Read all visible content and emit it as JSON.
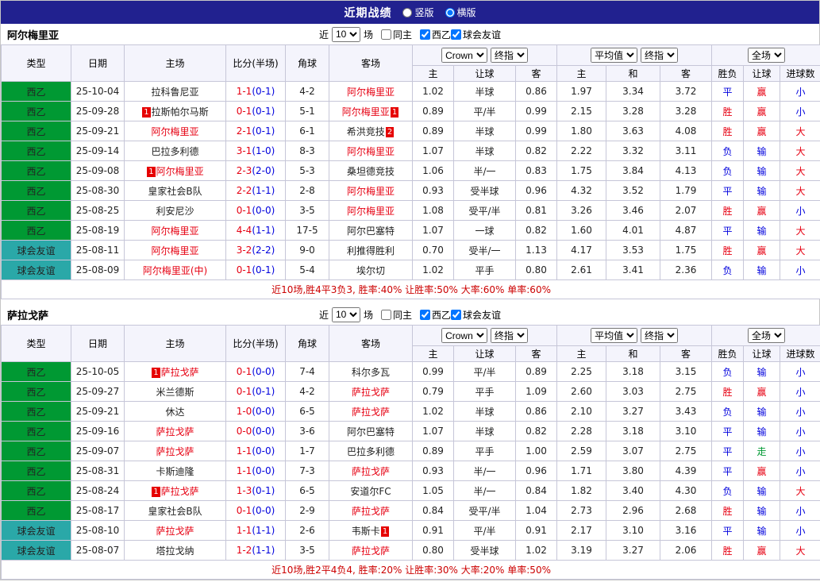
{
  "topbar": {
    "title": "近期战绩",
    "layout_options": [
      {
        "label": "竖版",
        "checked": false
      },
      {
        "label": "横版",
        "checked": true
      }
    ]
  },
  "labels": {
    "near": "近",
    "games": "场",
    "same_home": "同主",
    "league": "西乙",
    "friendly": "球会友谊"
  },
  "controls": {
    "count": "10",
    "bookmaker": "Crown",
    "stage1": "终指",
    "average": "平均值",
    "stage2": "终指",
    "scope": "全场"
  },
  "columns": {
    "type": "类型",
    "date": "日期",
    "home": "主场",
    "score": "比分(半场)",
    "corner": "角球",
    "away": "客场",
    "sub": [
      "主",
      "让球",
      "客",
      "主",
      "和",
      "客",
      "胜负",
      "让球",
      "进球数"
    ]
  },
  "colors": {
    "league": {
      "西乙": "#009933",
      "球会友谊": "#2aa8a8"
    },
    "result": {
      "胜": "#e60012",
      "平": "#0000dd",
      "负": "#0000dd",
      "赢": "#e60012",
      "输": "#0000dd",
      "走": "#009933",
      "大": "#e60012",
      "小": "#0000dd"
    }
  },
  "sections": [
    {
      "team": "阿尔梅里亚",
      "filter": {
        "same_home": false,
        "league_checked": true,
        "friendly_checked": true
      },
      "rows": [
        {
          "league": "西乙",
          "date": "25-10-04",
          "home": {
            "name": "拉科鲁尼亚"
          },
          "score": "1-1",
          "half": "0-1",
          "corner": "4-2",
          "away": {
            "name": "阿尔梅里亚",
            "feat": true
          },
          "odds": [
            "1.02",
            "半球",
            "0.86",
            "1.97",
            "3.34",
            "3.72"
          ],
          "res": [
            "平",
            "赢",
            "小"
          ]
        },
        {
          "league": "西乙",
          "date": "25-09-28",
          "home": {
            "name": "拉斯帕尔马斯",
            "badge_before": "1"
          },
          "score": "0-1",
          "half": "0-1",
          "corner": "5-1",
          "away": {
            "name": "阿尔梅里亚",
            "feat": true,
            "badge_after": "1"
          },
          "odds": [
            "0.89",
            "平/半",
            "0.99",
            "2.15",
            "3.28",
            "3.28"
          ],
          "res": [
            "胜",
            "赢",
            "小"
          ]
        },
        {
          "league": "西乙",
          "date": "25-09-21",
          "home": {
            "name": "阿尔梅里亚",
            "feat": true
          },
          "score": "2-1",
          "half": "0-1",
          "corner": "6-1",
          "away": {
            "name": "希洪竞技",
            "badge_after": "2"
          },
          "odds": [
            "0.89",
            "半球",
            "0.99",
            "1.80",
            "3.63",
            "4.08"
          ],
          "res": [
            "胜",
            "赢",
            "大"
          ]
        },
        {
          "league": "西乙",
          "date": "25-09-14",
          "home": {
            "name": "巴拉多利德"
          },
          "score": "3-1",
          "half": "1-0",
          "corner": "8-3",
          "away": {
            "name": "阿尔梅里亚",
            "feat": true
          },
          "odds": [
            "1.07",
            "半球",
            "0.82",
            "2.22",
            "3.32",
            "3.11"
          ],
          "res": [
            "负",
            "输",
            "大"
          ]
        },
        {
          "league": "西乙",
          "date": "25-09-08",
          "home": {
            "name": "阿尔梅里亚",
            "feat": true,
            "badge_before": "1"
          },
          "score": "2-3",
          "half": "2-0",
          "corner": "5-3",
          "away": {
            "name": "桑坦德竞技"
          },
          "odds": [
            "1.06",
            "半/一",
            "0.83",
            "1.75",
            "3.84",
            "4.13"
          ],
          "res": [
            "负",
            "输",
            "大"
          ]
        },
        {
          "league": "西乙",
          "date": "25-08-30",
          "home": {
            "name": "皇家社会B队"
          },
          "score": "2-2",
          "half": "1-1",
          "corner": "2-8",
          "away": {
            "name": "阿尔梅里亚",
            "feat": true
          },
          "odds": [
            "0.93",
            "受半球",
            "0.96",
            "4.32",
            "3.52",
            "1.79"
          ],
          "res": [
            "平",
            "输",
            "大"
          ]
        },
        {
          "league": "西乙",
          "date": "25-08-25",
          "home": {
            "name": "利安尼沙"
          },
          "score": "0-1",
          "half": "0-0",
          "corner": "3-5",
          "away": {
            "name": "阿尔梅里亚",
            "feat": true
          },
          "odds": [
            "1.08",
            "受平/半",
            "0.81",
            "3.26",
            "3.46",
            "2.07"
          ],
          "res": [
            "胜",
            "赢",
            "小"
          ]
        },
        {
          "league": "西乙",
          "date": "25-08-19",
          "home": {
            "name": "阿尔梅里亚",
            "feat": true
          },
          "score": "4-4",
          "half": "1-1",
          "corner": "17-5",
          "away": {
            "name": "阿尔巴塞特"
          },
          "odds": [
            "1.07",
            "一球",
            "0.82",
            "1.60",
            "4.01",
            "4.87"
          ],
          "res": [
            "平",
            "输",
            "大"
          ]
        },
        {
          "league": "球会友谊",
          "date": "25-08-11",
          "home": {
            "name": "阿尔梅里亚",
            "feat": true
          },
          "score": "3-2",
          "half": "2-2",
          "corner": "9-0",
          "away": {
            "name": "利推得胜利"
          },
          "odds": [
            "0.70",
            "受半/一",
            "1.13",
            "4.17",
            "3.53",
            "1.75"
          ],
          "res": [
            "胜",
            "赢",
            "大"
          ]
        },
        {
          "league": "球会友谊",
          "date": "25-08-09",
          "home": {
            "name": "阿尔梅里亚(中)",
            "feat": true
          },
          "score": "0-1",
          "half": "0-1",
          "corner": "5-4",
          "away": {
            "name": "埃尔切"
          },
          "odds": [
            "1.02",
            "平手",
            "0.80",
            "2.61",
            "3.41",
            "2.36"
          ],
          "res": [
            "负",
            "输",
            "小"
          ]
        }
      ],
      "summary": "近10场,胜4平3负3, 胜率:40% 让胜率:50% 大率:60% 单率:60%"
    },
    {
      "team": "萨拉戈萨",
      "filter": {
        "same_home": false,
        "league_checked": true,
        "friendly_checked": true
      },
      "rows": [
        {
          "league": "西乙",
          "date": "25-10-05",
          "home": {
            "name": "萨拉戈萨",
            "feat": true,
            "badge_before": "1"
          },
          "score": "0-1",
          "half": "0-0",
          "corner": "7-4",
          "away": {
            "name": "科尔多瓦"
          },
          "odds": [
            "0.99",
            "平/半",
            "0.89",
            "2.25",
            "3.18",
            "3.15"
          ],
          "res": [
            "负",
            "输",
            "小"
          ]
        },
        {
          "league": "西乙",
          "date": "25-09-27",
          "home": {
            "name": "米兰德斯"
          },
          "score": "0-1",
          "half": "0-1",
          "corner": "4-2",
          "away": {
            "name": "萨拉戈萨",
            "feat": true
          },
          "odds": [
            "0.79",
            "平手",
            "1.09",
            "2.60",
            "3.03",
            "2.75"
          ],
          "res": [
            "胜",
            "赢",
            "小"
          ]
        },
        {
          "league": "西乙",
          "date": "25-09-21",
          "home": {
            "name": "休达"
          },
          "score": "1-0",
          "half": "0-0",
          "corner": "6-5",
          "away": {
            "name": "萨拉戈萨",
            "feat": true
          },
          "odds": [
            "1.02",
            "半球",
            "0.86",
            "2.10",
            "3.27",
            "3.43"
          ],
          "res": [
            "负",
            "输",
            "小"
          ]
        },
        {
          "league": "西乙",
          "date": "25-09-16",
          "home": {
            "name": "萨拉戈萨",
            "feat": true
          },
          "score": "0-0",
          "half": "0-0",
          "corner": "3-6",
          "away": {
            "name": "阿尔巴塞特"
          },
          "odds": [
            "1.07",
            "半球",
            "0.82",
            "2.28",
            "3.18",
            "3.10"
          ],
          "res": [
            "平",
            "输",
            "小"
          ]
        },
        {
          "league": "西乙",
          "date": "25-09-07",
          "home": {
            "name": "萨拉戈萨",
            "feat": true
          },
          "score": "1-1",
          "half": "0-0",
          "corner": "1-7",
          "away": {
            "name": "巴拉多利德"
          },
          "odds": [
            "0.89",
            "平手",
            "1.00",
            "2.59",
            "3.07",
            "2.75"
          ],
          "res": [
            "平",
            "走",
            "小"
          ]
        },
        {
          "league": "西乙",
          "date": "25-08-31",
          "home": {
            "name": "卡斯迪隆"
          },
          "score": "1-1",
          "half": "0-0",
          "corner": "7-3",
          "away": {
            "name": "萨拉戈萨",
            "feat": true
          },
          "odds": [
            "0.93",
            "半/一",
            "0.96",
            "1.71",
            "3.80",
            "4.39"
          ],
          "res": [
            "平",
            "赢",
            "小"
          ]
        },
        {
          "league": "西乙",
          "date": "25-08-24",
          "home": {
            "name": "萨拉戈萨",
            "feat": true,
            "badge_before": "1"
          },
          "score": "1-3",
          "half": "0-1",
          "corner": "6-5",
          "away": {
            "name": "安道尔FC"
          },
          "odds": [
            "1.05",
            "半/一",
            "0.84",
            "1.82",
            "3.40",
            "4.30"
          ],
          "res": [
            "负",
            "输",
            "大"
          ]
        },
        {
          "league": "西乙",
          "date": "25-08-17",
          "home": {
            "name": "皇家社会B队"
          },
          "score": "0-1",
          "half": "0-0",
          "corner": "2-9",
          "away": {
            "name": "萨拉戈萨",
            "feat": true
          },
          "odds": [
            "0.84",
            "受平/半",
            "1.04",
            "2.73",
            "2.96",
            "2.68"
          ],
          "res": [
            "胜",
            "输",
            "小"
          ]
        },
        {
          "league": "球会友谊",
          "date": "25-08-10",
          "home": {
            "name": "萨拉戈萨",
            "feat": true
          },
          "score": "1-1",
          "half": "1-1",
          "corner": "2-6",
          "away": {
            "name": "韦斯卡",
            "badge_after": "1"
          },
          "odds": [
            "0.91",
            "平/半",
            "0.91",
            "2.17",
            "3.10",
            "3.16"
          ],
          "res": [
            "平",
            "输",
            "小"
          ]
        },
        {
          "league": "球会友谊",
          "date": "25-08-07",
          "home": {
            "name": "塔拉戈纳"
          },
          "score": "1-2",
          "half": "1-1",
          "corner": "3-5",
          "away": {
            "name": "萨拉戈萨",
            "feat": true
          },
          "odds": [
            "0.80",
            "受半球",
            "1.02",
            "3.19",
            "3.27",
            "2.06"
          ],
          "res": [
            "胜",
            "赢",
            "大"
          ]
        }
      ],
      "summary": "近10场,胜2平4负4, 胜率:20% 让胜率:30% 大率:20% 单率:50%"
    }
  ]
}
